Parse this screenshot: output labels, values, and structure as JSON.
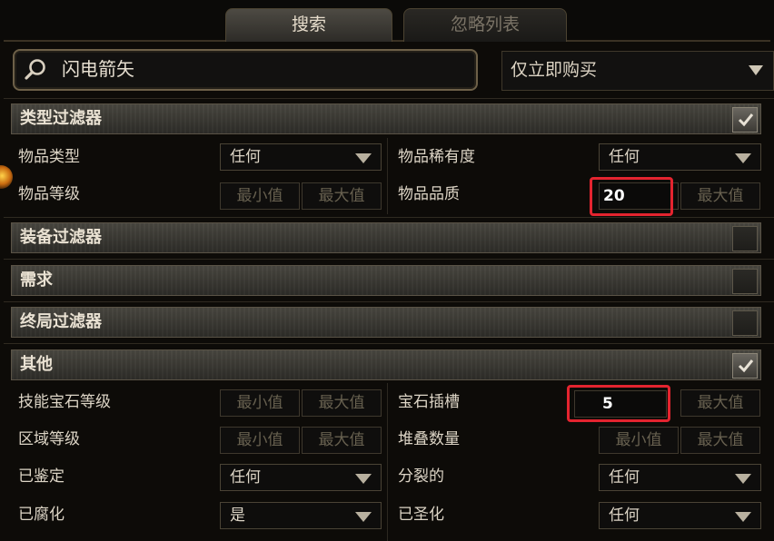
{
  "tabs": {
    "search": "搜索",
    "ignore_list": "忽略列表"
  },
  "search": {
    "value": "闪电箭矢",
    "buy_option": "仅立即购买"
  },
  "sections": {
    "type_filter": {
      "label": "类型过滤器",
      "checked": true
    },
    "equipment_filter": {
      "label": "装备过滤器",
      "checked": false
    },
    "requirements": {
      "label": "需求",
      "checked": false
    },
    "endgame_filter": {
      "label": "终局过滤器",
      "checked": false
    },
    "misc": {
      "label": "其他",
      "checked": true
    }
  },
  "fields": {
    "item_type": {
      "label": "物品类型",
      "value": "任何"
    },
    "item_rarity": {
      "label": "物品稀有度",
      "value": "任何"
    },
    "item_level": {
      "label": "物品等级",
      "min": "最小值",
      "max": "最大值"
    },
    "item_quality": {
      "label": "物品品质",
      "min_value": "20",
      "max": "最大值"
    },
    "gem_level": {
      "label": "技能宝石等级",
      "min": "最小值",
      "max": "最大值"
    },
    "gem_sockets": {
      "label": "宝石插槽",
      "min_value": "5",
      "max": "最大值"
    },
    "area_level": {
      "label": "区域等级",
      "min": "最小值",
      "max": "最大值"
    },
    "stack_size": {
      "label": "堆叠数量",
      "min": "最小值",
      "max": "最大值"
    },
    "identified": {
      "label": "已鉴定",
      "value": "任何"
    },
    "fractured": {
      "label": "分裂的",
      "value": "任何"
    },
    "corrupted": {
      "label": "已腐化",
      "value": "是"
    },
    "sanctified": {
      "label": "已圣化",
      "value": "任何"
    }
  },
  "colors": {
    "highlight": "#e4242f",
    "panel": "#0d0b08",
    "accent": "#6d6048"
  }
}
